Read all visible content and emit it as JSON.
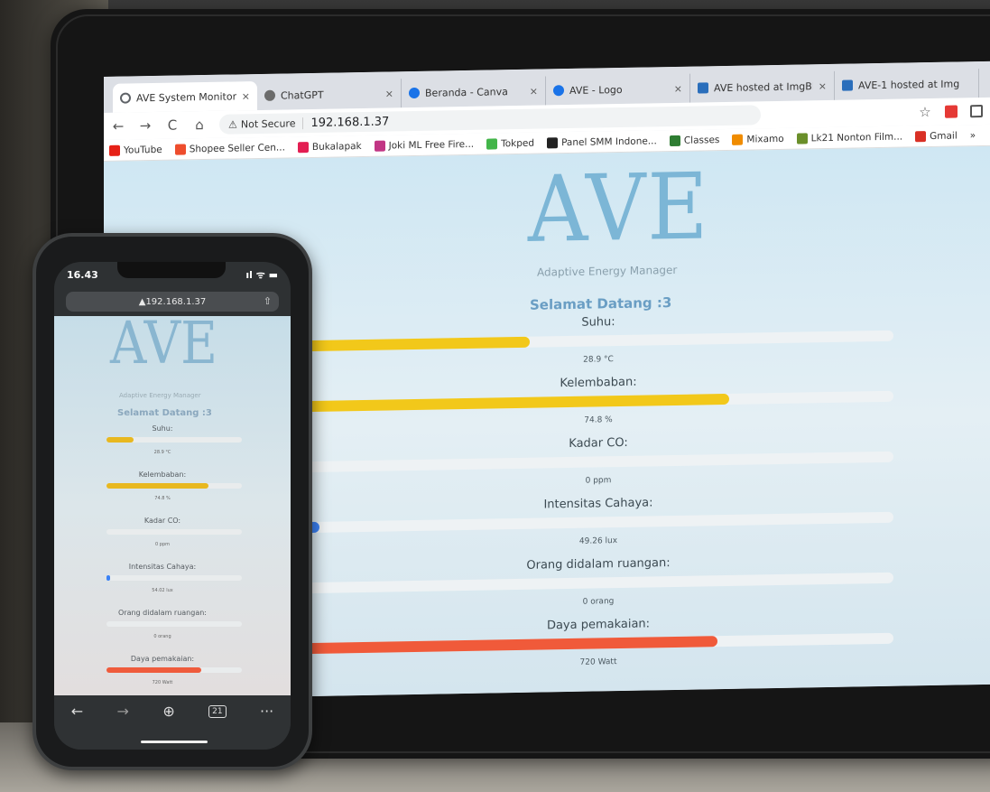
{
  "browser": {
    "tabs": [
      {
        "label": "AVE System Monitori",
        "active": true,
        "favicon_color": "#5f6368"
      },
      {
        "label": "ChatGPT",
        "active": false,
        "favicon_color": "#6b6b6b"
      },
      {
        "label": "Beranda - Canva",
        "active": false,
        "favicon_color": "#1a73e8"
      },
      {
        "label": "AVE - Logo",
        "active": false,
        "favicon_color": "#1a73e8"
      },
      {
        "label": "AVE hosted at ImgBE",
        "active": false,
        "favicon_color": "#2a6ebb"
      },
      {
        "label": "AVE-1 hosted at Img",
        "active": false,
        "favicon_color": "#2a6ebb"
      }
    ],
    "tab_close": "×",
    "nav": {
      "back": "←",
      "forward": "→",
      "reload": "C",
      "home": "⌂"
    },
    "not_secure": "Not Secure",
    "url": "192.168.1.37",
    "star": "☆",
    "bookmarks": [
      {
        "label": "YouTube",
        "color": "#e62117"
      },
      {
        "label": "Shopee Seller Cen...",
        "color": "#ee4d2d"
      },
      {
        "label": "Bukalapak",
        "color": "#e31e52"
      },
      {
        "label": "Joki ML Free Fire...",
        "color": "#c13584"
      },
      {
        "label": "Tokped",
        "color": "#42b549"
      },
      {
        "label": "Panel SMM Indone...",
        "color": "#222222"
      },
      {
        "label": "Classes",
        "color": "#2e7d32"
      },
      {
        "label": "Mixamo",
        "color": "#f08c00"
      },
      {
        "label": "Lk21 Nonton Film...",
        "color": "#6a8f2a"
      },
      {
        "label": "Gmail",
        "color": "#d93025"
      }
    ],
    "more": "»"
  },
  "laptop_page": {
    "logo": "AVE",
    "tagline": "Adaptive Energy Manager",
    "welcome": "Selamat Datang :3",
    "metrics": [
      {
        "label": "Suhu:",
        "value": "28.9 °C",
        "fill_fraction": 0.38,
        "color": "#f2c81a"
      },
      {
        "label": "Kelembaban:",
        "value": "74.8 %",
        "fill_fraction": 0.72,
        "color": "#f2c81a"
      },
      {
        "label": "Kadar CO:",
        "value": "0 ppm",
        "fill_fraction": 0.0,
        "color": "#f2c81a"
      },
      {
        "label": "Intensitas Cahaya:",
        "value": "49.26 lux",
        "fill_fraction": 0.02,
        "color": "#3b82f6"
      },
      {
        "label": "Orang didalam ruangan:",
        "value": "0 orang",
        "fill_fraction": 0.0,
        "color": "#f2c81a"
      },
      {
        "label": "Daya pemakaian:",
        "value": "720 Watt",
        "fill_fraction": 0.7,
        "color": "#f05a3a"
      }
    ]
  },
  "phone": {
    "time": "16.43",
    "status_icons": "ıl ᯤ ▬",
    "url": "▲192.168.1.37",
    "share_icon": "⇧",
    "page": {
      "logo": "AVE",
      "tagline": "Adaptive Energy Manager",
      "welcome": "Selamat Datang :3",
      "metrics": [
        {
          "label": "Suhu:",
          "value": "28.9 °C",
          "fill_fraction": 0.2,
          "color": "#e8b820"
        },
        {
          "label": "Kelembaban:",
          "value": "74.8 %",
          "fill_fraction": 0.75,
          "color": "#e8b820"
        },
        {
          "label": "Kadar CO:",
          "value": "0 ppm",
          "fill_fraction": 0.0,
          "color": "#e8b820"
        },
        {
          "label": "Intensitas Cahaya:",
          "value": "54.02 lux",
          "fill_fraction": 0.02,
          "color": "#3b82f6"
        },
        {
          "label": "Orang didalam ruangan:",
          "value": "0 orang",
          "fill_fraction": 0.0,
          "color": "#e8b820"
        },
        {
          "label": "Daya pemakaian:",
          "value": "720 Watt",
          "fill_fraction": 0.7,
          "color": "#ef5b3c"
        }
      ]
    },
    "toolbar": {
      "back": "←",
      "forward": "→",
      "new_tab": "⊕",
      "tabs": "21",
      "more": "···"
    }
  }
}
